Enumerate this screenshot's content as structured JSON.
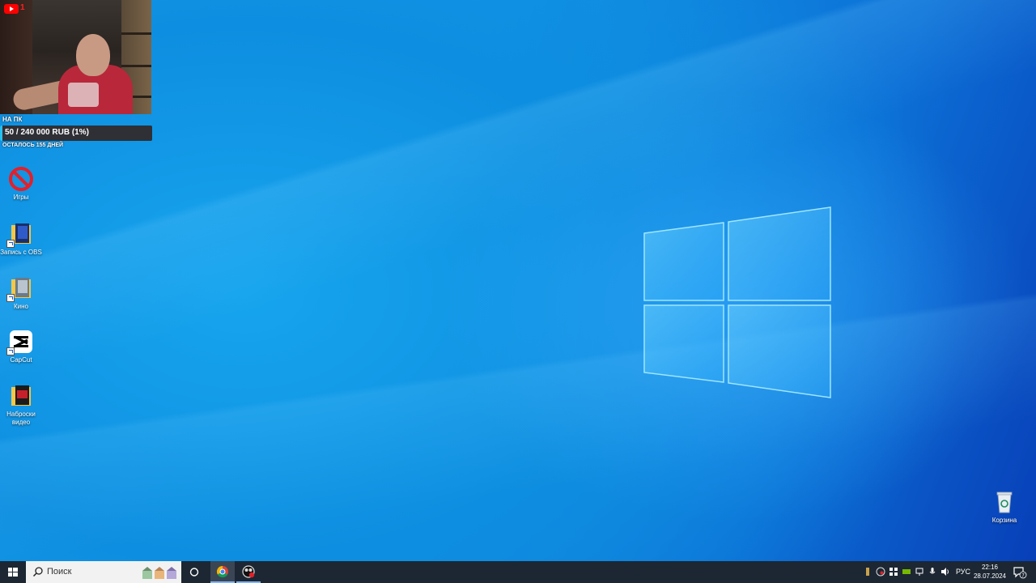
{
  "overlay": {
    "yt_count": "1",
    "goal": {
      "title": "НА ПК",
      "progress_text": "50 / 240 000 RUB (1%)",
      "progress_fraction": 0.01,
      "remaining": "ОСТАЛОСЬ 155 ДНЕЙ"
    }
  },
  "desktop": {
    "icons": [
      {
        "label": "Игры",
        "icon": "no-entry-icon"
      },
      {
        "label": "Запись с OBS",
        "icon": "folder-shortcut-icon"
      },
      {
        "label": "Кино",
        "icon": "folder-shortcut-icon"
      },
      {
        "label": "CapCut",
        "icon": "capcut-icon"
      },
      {
        "label": "Наброски видео",
        "icon": "folder-icon"
      }
    ],
    "recycle_bin": {
      "label": "Корзина",
      "icon": "recycle-bin-icon"
    }
  },
  "taskbar": {
    "search_placeholder": "Поиск",
    "pinned": [
      "chrome-icon",
      "obs-icon"
    ],
    "tray": {
      "language": "РУС",
      "time": "22:16",
      "date": "28.07.2024",
      "notification_count": "7"
    }
  },
  "colors": {
    "taskbar_bg": "#1c2733",
    "goal_fill": "#26c0f0",
    "wallpaper_accent": "#0e8ee0"
  }
}
